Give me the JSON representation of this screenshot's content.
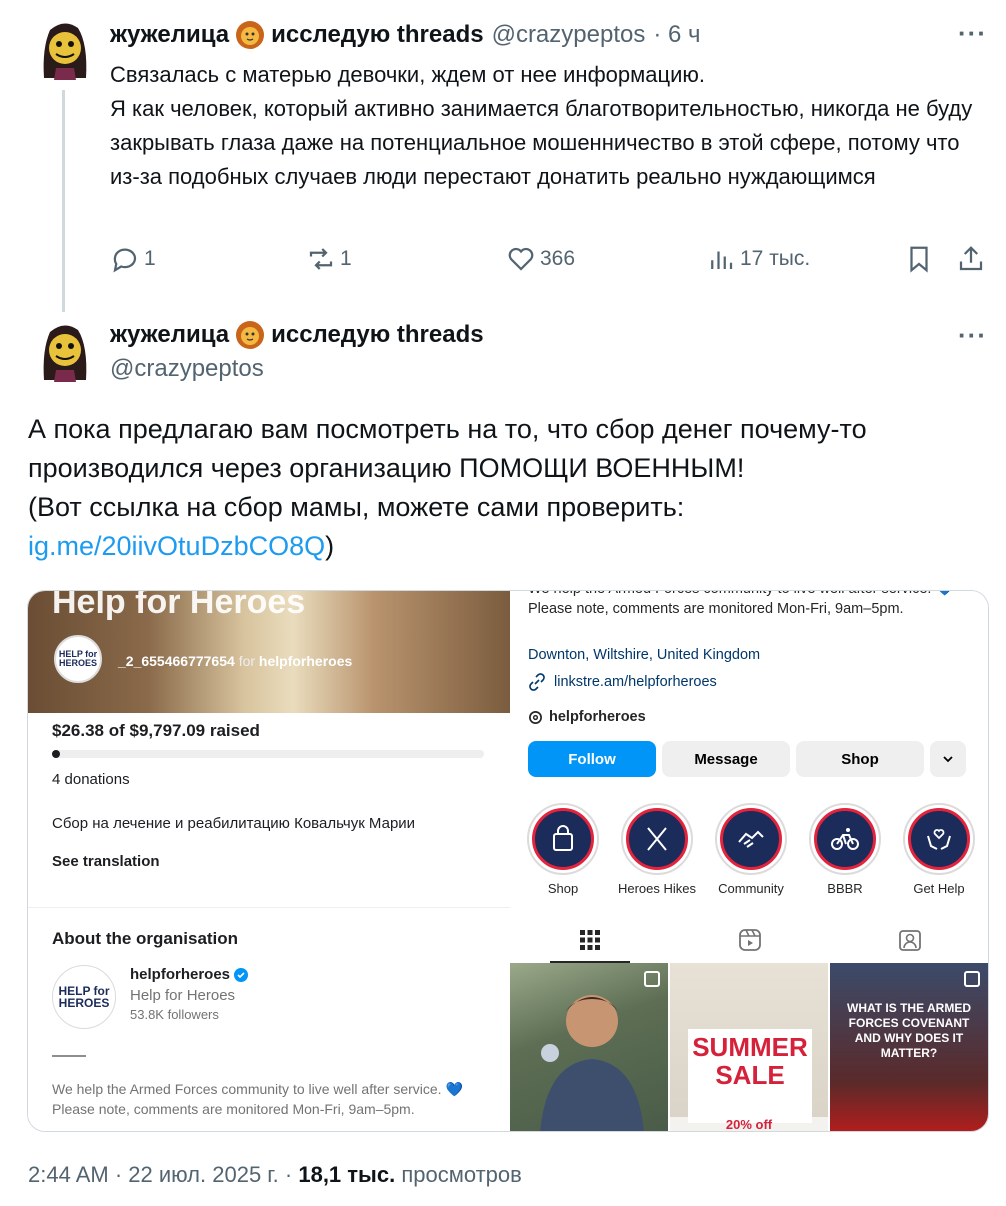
{
  "tweet1": {
    "author_name": "жужелица",
    "author_suffix": "исследую threads",
    "handle": "@crazypeptos",
    "time": "· 6 ч",
    "text": "Связалась с матерью девочки, ждем от нее информацию.\nЯ как человек, который активно занимается благотворительностью, никогда не буду закрывать глаза даже на потенциальное мошенничество в этой сфере, потому что из-за подобных случаев люди перестают донатить реально нуждающимся",
    "actions": {
      "replies": "1",
      "reposts": "1",
      "likes": "366",
      "views": "17 тыс."
    }
  },
  "tweet2": {
    "author_name": "жужелица",
    "author_suffix": "исследую threads",
    "handle": "@crazypeptos",
    "text_line1": "А пока предлагаю вам посмотреть на то, что сбор денег почему-то производился через организацию ПОМОЩИ ВОЕННЫМ!",
    "text_line2": "(Вот ссылка на сбор мамы, можете сами проверить:",
    "link": "ig.me/20iivOtuDzbCO8Q",
    "link_close": ")"
  },
  "more_glyph": "···",
  "media": {
    "fundraiser": {
      "banner_title": "Help for Heroes",
      "logo_text": "HELP for HEROES",
      "user_name": "_2_655466777654",
      "user_for": "for",
      "org_handle": "helpforheroes",
      "raised_text": "$26.38 of $9,797.09 raised",
      "raised_amount": 26.38,
      "goal_amount": 9797.09,
      "donations": "4 donations",
      "description": "Сбор на лечение и реабилитацию Ковальчук Марии",
      "see_translation": "See translation",
      "about_heading": "About the organisation",
      "org_logo_text": "HELP for HEROES",
      "org_name": "helpforheroes",
      "org_full_name": "Help for Heroes",
      "org_followers": "53.8K followers",
      "org_bio": "We help the Armed Forces community to live well after service. 💙 Please note, comments are monitored Mon-Fri, 9am–5pm."
    },
    "profile": {
      "bio": "We help the Armed Forces community to live well after service. 💙 Please note, comments are monitored Mon-Fri, 9am–5pm.",
      "location": "Downton, Wiltshire, United Kingdom",
      "link": "linkstre.am/helpforheroes",
      "threads_handle": "helpforheroes",
      "buttons": {
        "follow": "Follow",
        "message": "Message",
        "shop": "Shop",
        "more_icon": "chevron-down-icon"
      },
      "highlights": [
        {
          "label": "Shop",
          "icon": "bag-icon"
        },
        {
          "label": "Heroes Hikes",
          "icon": "poles-icon"
        },
        {
          "label": "Community",
          "icon": "handshake-icon"
        },
        {
          "label": "BBBR",
          "icon": "bike-icon"
        },
        {
          "label": "Get Help",
          "icon": "heart-hands-icon"
        }
      ],
      "tabs": [
        "grid-icon",
        "reels-icon",
        "tagged-icon"
      ],
      "posts": [
        {
          "overlay": ""
        },
        {
          "overlay": "SUMMER SALE",
          "sub": "20% off"
        },
        {
          "overlay": "WHAT IS THE ARMED FORCES COVENANT AND WHY DOES IT MATTER?"
        }
      ]
    }
  },
  "footer": {
    "time": "2:44 AM",
    "date": "22 июл. 2025 г.",
    "views_count": "18,1 тыс.",
    "views_label": "просмотров",
    "sep": "·"
  },
  "colors": {
    "accent": "#1d9bf0",
    "muted": "#536471",
    "ig_blue": "#0095f6",
    "hfh_navy": "#1b2b5a",
    "hfh_red": "#e4243c"
  }
}
